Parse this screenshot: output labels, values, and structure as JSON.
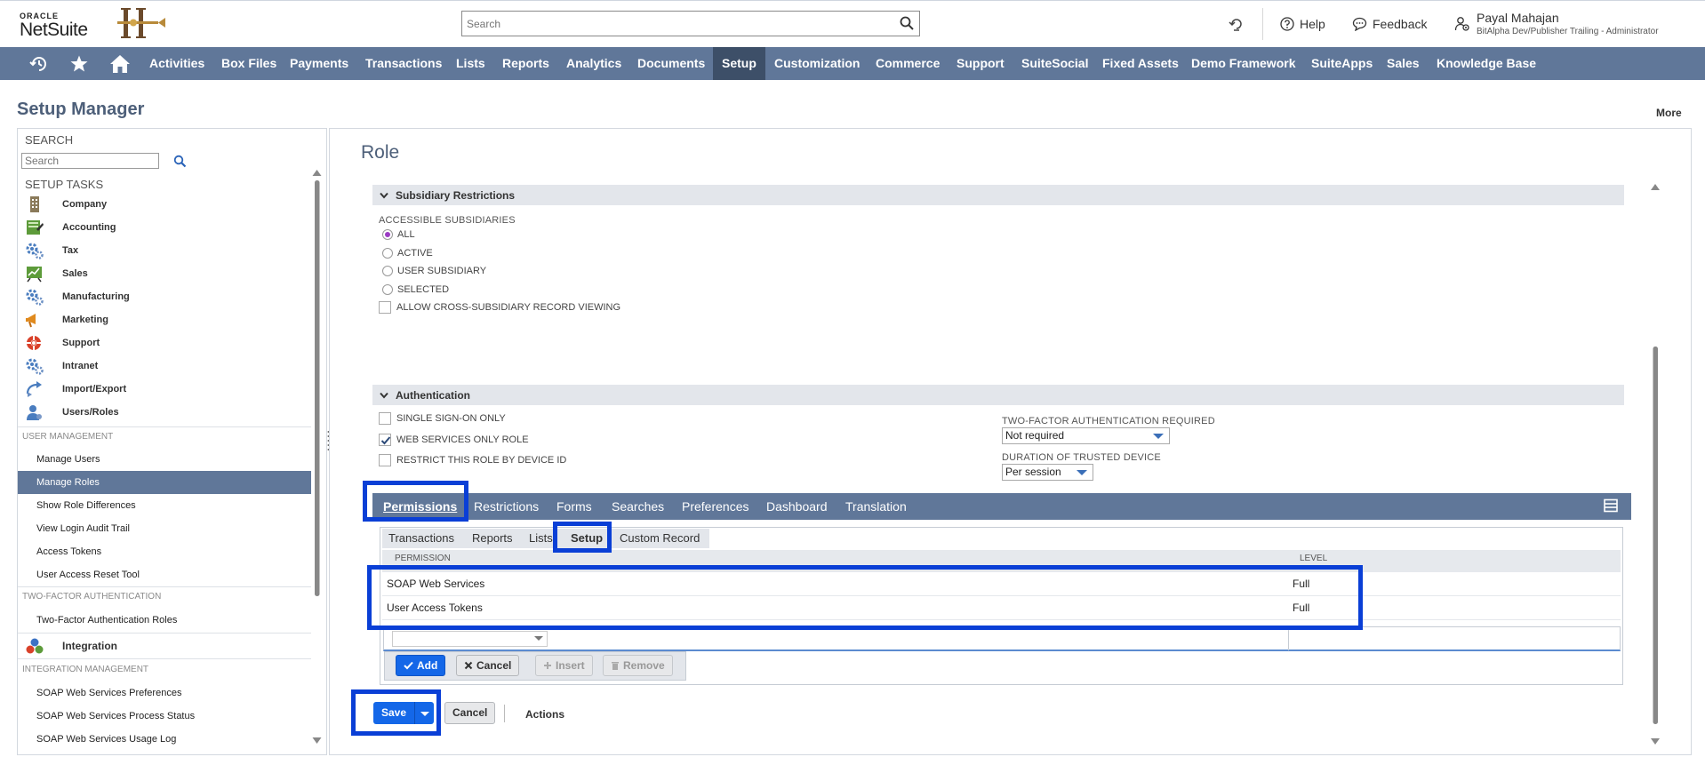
{
  "header": {
    "logo_oracle": "ORACLE",
    "logo_netsuite": "NetSuite",
    "search_placeholder": "Search",
    "help": "Help",
    "feedback": "Feedback",
    "user_name": "Payal Mahajan",
    "user_role": "BitAlpha Dev/Publisher Trailing - Administrator"
  },
  "nav": {
    "items": [
      "Activities",
      "Box Files",
      "Payments",
      "Transactions",
      "Lists",
      "Reports",
      "Analytics",
      "Documents",
      "Setup",
      "Customization",
      "Commerce",
      "Support",
      "SuiteSocial",
      "Fixed Assets",
      "Demo Framework",
      "SuiteApps",
      "Sales",
      "Knowledge Base"
    ],
    "active": "Setup"
  },
  "page": {
    "title": "Setup Manager",
    "more": "More"
  },
  "sidebar": {
    "search_heading": "SEARCH",
    "search_placeholder": "Search",
    "setup_tasks_heading": "SETUP TASKS",
    "tasks": [
      "Company",
      "Accounting",
      "Tax",
      "Sales",
      "Manufacturing",
      "Marketing",
      "Support",
      "Intranet",
      "Import/Export",
      "Users/Roles"
    ],
    "user_management_heading": "USER MANAGEMENT",
    "user_management": [
      "Manage Users",
      "Manage Roles",
      "Show Role Differences",
      "View Login Audit Trail",
      "Access Tokens",
      "User Access Reset Tool"
    ],
    "two_factor_heading": "TWO-FACTOR AUTHENTICATION",
    "two_factor": [
      "Two-Factor Authentication Roles"
    ],
    "integration": "Integration",
    "integration_mgmt_heading": "INTEGRATION MANAGEMENT",
    "integration_mgmt": [
      "SOAP Web Services Preferences",
      "SOAP Web Services Process Status",
      "SOAP Web Services Usage Log"
    ]
  },
  "main": {
    "role_title": "Role",
    "subsidiary_section": "Subsidiary Restrictions",
    "accessible_subsidiaries_label": "ACCESSIBLE SUBSIDIARIES",
    "subsidiary_options": [
      "ALL",
      "ACTIVE",
      "USER SUBSIDIARY",
      "SELECTED"
    ],
    "subsidiary_selected": "ALL",
    "allow_cross_subsidiary": "ALLOW CROSS-SUBSIDIARY RECORD VIEWING",
    "authentication_section": "Authentication",
    "single_sign_on": "SINGLE SIGN-ON ONLY",
    "web_services_only": "WEB SERVICES ONLY ROLE",
    "web_services_only_checked": true,
    "restrict_device": "RESTRICT THIS ROLE BY DEVICE ID",
    "two_factor_label": "TWO-FACTOR AUTHENTICATION REQUIRED",
    "two_factor_value": "Not required",
    "trusted_device_label": "DURATION OF TRUSTED DEVICE",
    "trusted_device_value": "Per session"
  },
  "tabs": {
    "items": [
      "Permissions",
      "Restrictions",
      "Forms",
      "Searches",
      "Preferences",
      "Dashboard",
      "Translation"
    ],
    "active": "Permissions",
    "subtabs": [
      "Transactions",
      "Reports",
      "Lists",
      "Setup",
      "Custom Record"
    ],
    "active_subtab": "Setup"
  },
  "permissions_table": {
    "col_permission": "PERMISSION",
    "col_level": "LEVEL",
    "rows": [
      {
        "permission": "SOAP Web Services",
        "level": "Full"
      },
      {
        "permission": "User Access Tokens",
        "level": "Full"
      }
    ]
  },
  "buttons": {
    "add": "Add",
    "cancel_line": "Cancel",
    "insert": "Insert",
    "remove": "Remove",
    "save": "Save",
    "cancel": "Cancel",
    "actions": "Actions"
  },
  "colors": {
    "nav_bg": "#607799",
    "nav_active": "#3d4f68",
    "primary_button": "#1467e8",
    "highlight_box": "#0a3fd6"
  }
}
